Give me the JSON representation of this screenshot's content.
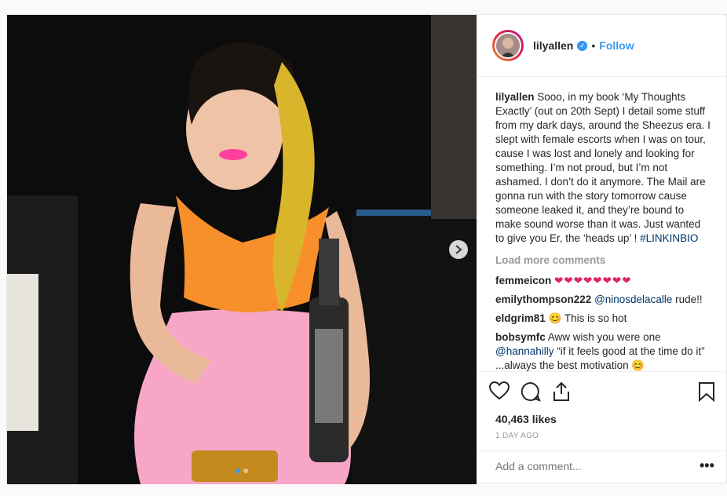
{
  "post": {
    "username": "lilyallen",
    "follow_label": "Follow",
    "separator": "•",
    "caption": {
      "username": "lilyallen",
      "text": " Sooo, in my book ‘My Thoughts Exactly’ (out on 20th Sept) I detail some stuff from my dark days, around the Sheezus era. I slept with female escorts when I was on tour, cause I was lost and lonely and looking for something. I’m not proud, but I’m not ashamed. I don’t do it anymore. The Mail are gonna run with the story tomorrow cause someone leaked it, and they’re bound to make sound worse than it was. Just wanted to give you Er, the ‘heads up’ ! ",
      "hashtag": "#LINKINBIO"
    },
    "load_more": "Load more comments",
    "comments": [
      {
        "user": "femmeicon",
        "text": "",
        "hearts": "❤❤❤❤❤❤❤❤"
      },
      {
        "user": "emilythompson222",
        "mention": "@ninosdelacalle",
        "text": " rude!!"
      },
      {
        "user": "eldgrim81",
        "emoji": "😊",
        "text": " This is so hot"
      },
      {
        "user": "bobsymfc",
        "text": " Aww wish you were one ",
        "mention": "@hannahilly",
        "text2": " “if it feels good at the time do it” ...always the best motivation 😊"
      }
    ],
    "likes": "40,463 likes",
    "time": "1 DAY AGO",
    "add_comment_placeholder": "Add a comment...",
    "more_options": "•••",
    "carousel": {
      "current": 1,
      "total": 2
    }
  },
  "colors": {
    "accent": "#3897f0",
    "heart": "#e0245e",
    "muted": "#999999"
  },
  "icons": [
    "verified-badge-icon",
    "chevron-right-icon",
    "heart-icon",
    "comment-icon",
    "share-icon",
    "bookmark-icon",
    "more-options-icon"
  ]
}
